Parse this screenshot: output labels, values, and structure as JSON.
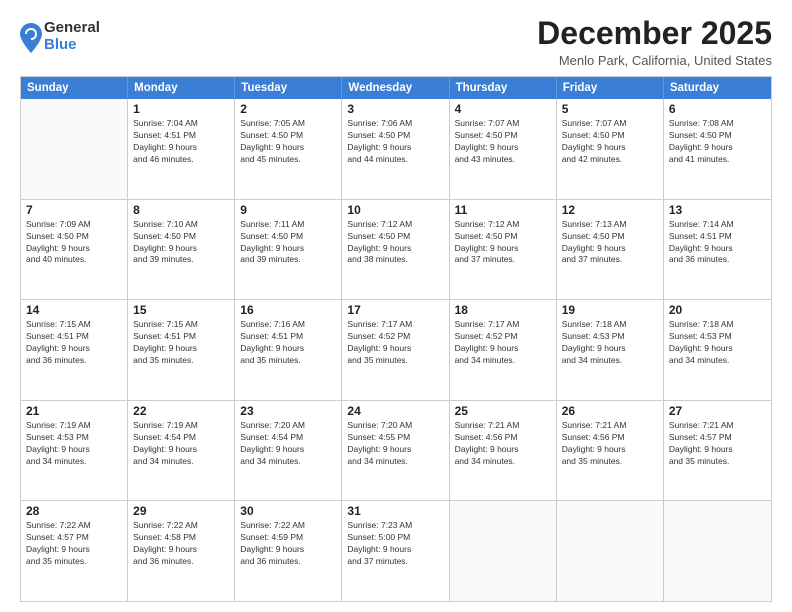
{
  "logo": {
    "general": "General",
    "blue": "Blue"
  },
  "title": "December 2025",
  "location": "Menlo Park, California, United States",
  "header_days": [
    "Sunday",
    "Monday",
    "Tuesday",
    "Wednesday",
    "Thursday",
    "Friday",
    "Saturday"
  ],
  "weeks": [
    [
      {
        "day": "",
        "info": ""
      },
      {
        "day": "1",
        "info": "Sunrise: 7:04 AM\nSunset: 4:51 PM\nDaylight: 9 hours\nand 46 minutes."
      },
      {
        "day": "2",
        "info": "Sunrise: 7:05 AM\nSunset: 4:50 PM\nDaylight: 9 hours\nand 45 minutes."
      },
      {
        "day": "3",
        "info": "Sunrise: 7:06 AM\nSunset: 4:50 PM\nDaylight: 9 hours\nand 44 minutes."
      },
      {
        "day": "4",
        "info": "Sunrise: 7:07 AM\nSunset: 4:50 PM\nDaylight: 9 hours\nand 43 minutes."
      },
      {
        "day": "5",
        "info": "Sunrise: 7:07 AM\nSunset: 4:50 PM\nDaylight: 9 hours\nand 42 minutes."
      },
      {
        "day": "6",
        "info": "Sunrise: 7:08 AM\nSunset: 4:50 PM\nDaylight: 9 hours\nand 41 minutes."
      }
    ],
    [
      {
        "day": "7",
        "info": "Sunrise: 7:09 AM\nSunset: 4:50 PM\nDaylight: 9 hours\nand 40 minutes."
      },
      {
        "day": "8",
        "info": "Sunrise: 7:10 AM\nSunset: 4:50 PM\nDaylight: 9 hours\nand 39 minutes."
      },
      {
        "day": "9",
        "info": "Sunrise: 7:11 AM\nSunset: 4:50 PM\nDaylight: 9 hours\nand 39 minutes."
      },
      {
        "day": "10",
        "info": "Sunrise: 7:12 AM\nSunset: 4:50 PM\nDaylight: 9 hours\nand 38 minutes."
      },
      {
        "day": "11",
        "info": "Sunrise: 7:12 AM\nSunset: 4:50 PM\nDaylight: 9 hours\nand 37 minutes."
      },
      {
        "day": "12",
        "info": "Sunrise: 7:13 AM\nSunset: 4:50 PM\nDaylight: 9 hours\nand 37 minutes."
      },
      {
        "day": "13",
        "info": "Sunrise: 7:14 AM\nSunset: 4:51 PM\nDaylight: 9 hours\nand 36 minutes."
      }
    ],
    [
      {
        "day": "14",
        "info": "Sunrise: 7:15 AM\nSunset: 4:51 PM\nDaylight: 9 hours\nand 36 minutes."
      },
      {
        "day": "15",
        "info": "Sunrise: 7:15 AM\nSunset: 4:51 PM\nDaylight: 9 hours\nand 35 minutes."
      },
      {
        "day": "16",
        "info": "Sunrise: 7:16 AM\nSunset: 4:51 PM\nDaylight: 9 hours\nand 35 minutes."
      },
      {
        "day": "17",
        "info": "Sunrise: 7:17 AM\nSunset: 4:52 PM\nDaylight: 9 hours\nand 35 minutes."
      },
      {
        "day": "18",
        "info": "Sunrise: 7:17 AM\nSunset: 4:52 PM\nDaylight: 9 hours\nand 34 minutes."
      },
      {
        "day": "19",
        "info": "Sunrise: 7:18 AM\nSunset: 4:53 PM\nDaylight: 9 hours\nand 34 minutes."
      },
      {
        "day": "20",
        "info": "Sunrise: 7:18 AM\nSunset: 4:53 PM\nDaylight: 9 hours\nand 34 minutes."
      }
    ],
    [
      {
        "day": "21",
        "info": "Sunrise: 7:19 AM\nSunset: 4:53 PM\nDaylight: 9 hours\nand 34 minutes."
      },
      {
        "day": "22",
        "info": "Sunrise: 7:19 AM\nSunset: 4:54 PM\nDaylight: 9 hours\nand 34 minutes."
      },
      {
        "day": "23",
        "info": "Sunrise: 7:20 AM\nSunset: 4:54 PM\nDaylight: 9 hours\nand 34 minutes."
      },
      {
        "day": "24",
        "info": "Sunrise: 7:20 AM\nSunset: 4:55 PM\nDaylight: 9 hours\nand 34 minutes."
      },
      {
        "day": "25",
        "info": "Sunrise: 7:21 AM\nSunset: 4:56 PM\nDaylight: 9 hours\nand 34 minutes."
      },
      {
        "day": "26",
        "info": "Sunrise: 7:21 AM\nSunset: 4:56 PM\nDaylight: 9 hours\nand 35 minutes."
      },
      {
        "day": "27",
        "info": "Sunrise: 7:21 AM\nSunset: 4:57 PM\nDaylight: 9 hours\nand 35 minutes."
      }
    ],
    [
      {
        "day": "28",
        "info": "Sunrise: 7:22 AM\nSunset: 4:57 PM\nDaylight: 9 hours\nand 35 minutes."
      },
      {
        "day": "29",
        "info": "Sunrise: 7:22 AM\nSunset: 4:58 PM\nDaylight: 9 hours\nand 36 minutes."
      },
      {
        "day": "30",
        "info": "Sunrise: 7:22 AM\nSunset: 4:59 PM\nDaylight: 9 hours\nand 36 minutes."
      },
      {
        "day": "31",
        "info": "Sunrise: 7:23 AM\nSunset: 5:00 PM\nDaylight: 9 hours\nand 37 minutes."
      },
      {
        "day": "",
        "info": ""
      },
      {
        "day": "",
        "info": ""
      },
      {
        "day": "",
        "info": ""
      }
    ]
  ]
}
